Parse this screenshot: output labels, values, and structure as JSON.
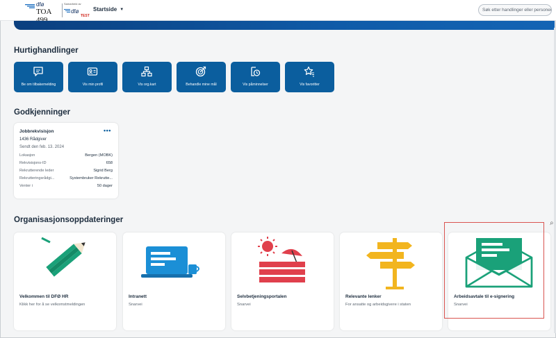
{
  "header": {
    "brand": "dfø",
    "tenant": "TOA 499",
    "secondary_small": "Samarbeid av",
    "secondary_brand": "dfø",
    "secondary_badge": "TEST",
    "nav_label": "Startside",
    "search_placeholder": "Søk etter handlinger eller personer"
  },
  "quick_actions": {
    "title": "Hurtighandlinger",
    "items": [
      {
        "label": "Be om tilbakemelding",
        "icon": "feedback-icon"
      },
      {
        "label": "Vis min profil",
        "icon": "profile-card-icon"
      },
      {
        "label": "Vis org.kart",
        "icon": "org-chart-icon"
      },
      {
        "label": "Behandle mine mål",
        "icon": "target-icon"
      },
      {
        "label": "Vis påminnelser",
        "icon": "reminder-icon"
      },
      {
        "label": "Vis favoritter",
        "icon": "favorites-icon"
      }
    ]
  },
  "approvals": {
    "title": "Godkjenninger",
    "card": {
      "title": "Jobbrekvisisjon",
      "more": "•••",
      "subtitle": "1436 Rådgiver",
      "date": "Sendt den feb. 13. 2024",
      "rows": [
        {
          "key": "Lokasjon",
          "value": "Bergen (MOBK)"
        },
        {
          "key": "Rekvisisjons-ID",
          "value": "658"
        },
        {
          "key": "Rekrutterende leder",
          "value": "Sigrid Berg"
        },
        {
          "key": "Rekrutteringsrådgi...",
          "value": "Systembruker Rekrutte..."
        },
        {
          "key": "Venter i",
          "value": "50 dager"
        }
      ]
    }
  },
  "org_updates": {
    "title": "Organisasjonsoppdateringer",
    "tiles": [
      {
        "title": "Velkommen til DFØ HR",
        "subtitle": "Klikk her for å se velkomstmeldingen"
      },
      {
        "title": "Intranett",
        "subtitle": "Snarvei"
      },
      {
        "title": "Selvbetjeningsportalen",
        "subtitle": "Snarvei"
      },
      {
        "title": "Relevante lenker",
        "subtitle": "For ansatte og arbeidsgivere i staten"
      },
      {
        "title": "Arbeidsavtale til e-signering",
        "subtitle": "Snarvei"
      }
    ]
  },
  "colors": {
    "primary": "#0b5e9e",
    "banner": "#0f5ba8",
    "green": "#1aa179",
    "red": "#e0404c",
    "yellow": "#f2b51f",
    "highlight": "#d9534f"
  }
}
